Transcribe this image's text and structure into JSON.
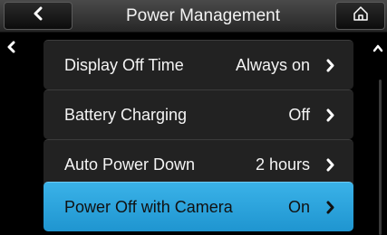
{
  "header": {
    "title": "Power Management",
    "back_icon": "chevron-left-icon",
    "home_icon": "home-icon"
  },
  "menu": {
    "items": [
      {
        "label": "Display Off Time",
        "value": "Always on",
        "selected": false
      },
      {
        "label": "Battery Charging",
        "value": "Off",
        "selected": false
      },
      {
        "label": "Auto Power Down",
        "value": "2 hours",
        "selected": false
      },
      {
        "label": "Power Off with Camera",
        "value": "On",
        "selected": true
      }
    ]
  },
  "colors": {
    "highlight": "#2aa3dc",
    "row_background": "#222222",
    "header_background": "#3a3a3a"
  }
}
